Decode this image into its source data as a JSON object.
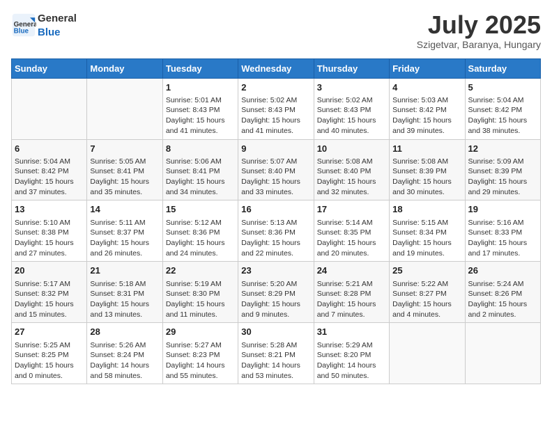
{
  "header": {
    "logo_general": "General",
    "logo_blue": "Blue",
    "month_year": "July 2025",
    "location": "Szigetvar, Baranya, Hungary"
  },
  "columns": [
    "Sunday",
    "Monday",
    "Tuesday",
    "Wednesday",
    "Thursday",
    "Friday",
    "Saturday"
  ],
  "weeks": [
    [
      {
        "day": "",
        "info": ""
      },
      {
        "day": "",
        "info": ""
      },
      {
        "day": "1",
        "info": "Sunrise: 5:01 AM\nSunset: 8:43 PM\nDaylight: 15 hours and 41 minutes."
      },
      {
        "day": "2",
        "info": "Sunrise: 5:02 AM\nSunset: 8:43 PM\nDaylight: 15 hours and 41 minutes."
      },
      {
        "day": "3",
        "info": "Sunrise: 5:02 AM\nSunset: 8:43 PM\nDaylight: 15 hours and 40 minutes."
      },
      {
        "day": "4",
        "info": "Sunrise: 5:03 AM\nSunset: 8:42 PM\nDaylight: 15 hours and 39 minutes."
      },
      {
        "day": "5",
        "info": "Sunrise: 5:04 AM\nSunset: 8:42 PM\nDaylight: 15 hours and 38 minutes."
      }
    ],
    [
      {
        "day": "6",
        "info": "Sunrise: 5:04 AM\nSunset: 8:42 PM\nDaylight: 15 hours and 37 minutes."
      },
      {
        "day": "7",
        "info": "Sunrise: 5:05 AM\nSunset: 8:41 PM\nDaylight: 15 hours and 35 minutes."
      },
      {
        "day": "8",
        "info": "Sunrise: 5:06 AM\nSunset: 8:41 PM\nDaylight: 15 hours and 34 minutes."
      },
      {
        "day": "9",
        "info": "Sunrise: 5:07 AM\nSunset: 8:40 PM\nDaylight: 15 hours and 33 minutes."
      },
      {
        "day": "10",
        "info": "Sunrise: 5:08 AM\nSunset: 8:40 PM\nDaylight: 15 hours and 32 minutes."
      },
      {
        "day": "11",
        "info": "Sunrise: 5:08 AM\nSunset: 8:39 PM\nDaylight: 15 hours and 30 minutes."
      },
      {
        "day": "12",
        "info": "Sunrise: 5:09 AM\nSunset: 8:39 PM\nDaylight: 15 hours and 29 minutes."
      }
    ],
    [
      {
        "day": "13",
        "info": "Sunrise: 5:10 AM\nSunset: 8:38 PM\nDaylight: 15 hours and 27 minutes."
      },
      {
        "day": "14",
        "info": "Sunrise: 5:11 AM\nSunset: 8:37 PM\nDaylight: 15 hours and 26 minutes."
      },
      {
        "day": "15",
        "info": "Sunrise: 5:12 AM\nSunset: 8:36 PM\nDaylight: 15 hours and 24 minutes."
      },
      {
        "day": "16",
        "info": "Sunrise: 5:13 AM\nSunset: 8:36 PM\nDaylight: 15 hours and 22 minutes."
      },
      {
        "day": "17",
        "info": "Sunrise: 5:14 AM\nSunset: 8:35 PM\nDaylight: 15 hours and 20 minutes."
      },
      {
        "day": "18",
        "info": "Sunrise: 5:15 AM\nSunset: 8:34 PM\nDaylight: 15 hours and 19 minutes."
      },
      {
        "day": "19",
        "info": "Sunrise: 5:16 AM\nSunset: 8:33 PM\nDaylight: 15 hours and 17 minutes."
      }
    ],
    [
      {
        "day": "20",
        "info": "Sunrise: 5:17 AM\nSunset: 8:32 PM\nDaylight: 15 hours and 15 minutes."
      },
      {
        "day": "21",
        "info": "Sunrise: 5:18 AM\nSunset: 8:31 PM\nDaylight: 15 hours and 13 minutes."
      },
      {
        "day": "22",
        "info": "Sunrise: 5:19 AM\nSunset: 8:30 PM\nDaylight: 15 hours and 11 minutes."
      },
      {
        "day": "23",
        "info": "Sunrise: 5:20 AM\nSunset: 8:29 PM\nDaylight: 15 hours and 9 minutes."
      },
      {
        "day": "24",
        "info": "Sunrise: 5:21 AM\nSunset: 8:28 PM\nDaylight: 15 hours and 7 minutes."
      },
      {
        "day": "25",
        "info": "Sunrise: 5:22 AM\nSunset: 8:27 PM\nDaylight: 15 hours and 4 minutes."
      },
      {
        "day": "26",
        "info": "Sunrise: 5:24 AM\nSunset: 8:26 PM\nDaylight: 15 hours and 2 minutes."
      }
    ],
    [
      {
        "day": "27",
        "info": "Sunrise: 5:25 AM\nSunset: 8:25 PM\nDaylight: 15 hours and 0 minutes."
      },
      {
        "day": "28",
        "info": "Sunrise: 5:26 AM\nSunset: 8:24 PM\nDaylight: 14 hours and 58 minutes."
      },
      {
        "day": "29",
        "info": "Sunrise: 5:27 AM\nSunset: 8:23 PM\nDaylight: 14 hours and 55 minutes."
      },
      {
        "day": "30",
        "info": "Sunrise: 5:28 AM\nSunset: 8:21 PM\nDaylight: 14 hours and 53 minutes."
      },
      {
        "day": "31",
        "info": "Sunrise: 5:29 AM\nSunset: 8:20 PM\nDaylight: 14 hours and 50 minutes."
      },
      {
        "day": "",
        "info": ""
      },
      {
        "day": "",
        "info": ""
      }
    ]
  ]
}
